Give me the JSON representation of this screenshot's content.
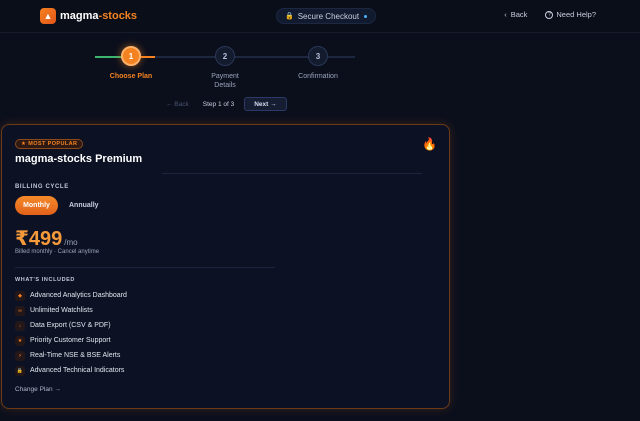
{
  "brand": {
    "prefix": "magma",
    "suffix": "-stocks"
  },
  "header": {
    "secure_label": "Secure Checkout",
    "back_label": "Back",
    "help_label": "Need Help?",
    "lock_glyph": "🔒",
    "back_glyph": "‹",
    "help_glyph": "?"
  },
  "steps": [
    {
      "number": "1",
      "label": "Choose Plan"
    },
    {
      "number": "2",
      "label": "Payment Details"
    },
    {
      "number": "3",
      "label": "Confirmation"
    }
  ],
  "step_nav": {
    "back_label": "← Back",
    "step_text": "Step 1 of 3",
    "next_label": "Next →"
  },
  "plan": {
    "badge": "★ MOST POPULAR",
    "title": "magma-stocks Premium",
    "flame_glyph": "🔥",
    "billing_label": "BILLING CYCLE",
    "monthly_label": "Monthly",
    "annually_label": "Annually",
    "price": "₹499",
    "price_unit": "/mo",
    "billed_note": "Billed monthly · Cancel anytime",
    "included_label": "WHAT'S INCLUDED",
    "features": [
      {
        "icon": "◆",
        "label": "Advanced Analytics Dashboard"
      },
      {
        "icon": "∞",
        "label": "Unlimited Watchlists"
      },
      {
        "icon": "↓",
        "label": "Data Export (CSV & PDF)"
      },
      {
        "icon": "★",
        "label": "Priority Customer Support"
      },
      {
        "icon": "⚡",
        "label": "Real-Time NSE & BSE Alerts"
      },
      {
        "icon": "🔒",
        "label": "Advanced Technical Indicators"
      }
    ],
    "change_plan": "Change Plan →"
  },
  "colors": {
    "accent": "#f58220",
    "background": "#0b0f1c",
    "card": "#0c1224"
  }
}
